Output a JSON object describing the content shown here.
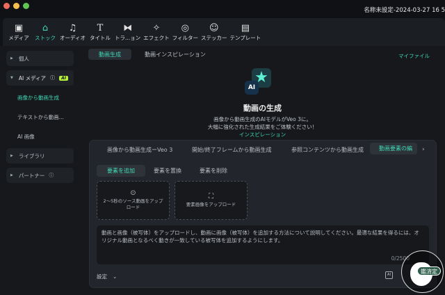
{
  "window": {
    "title": "名称未設定-2024-03-27 16 5"
  },
  "toolbar": [
    {
      "label": "メディア",
      "icon": "media-icon"
    },
    {
      "label": "ストック",
      "icon": "store-icon"
    },
    {
      "label": "オーディオ",
      "icon": "music-icon"
    },
    {
      "label": "タイトル",
      "icon": "title-icon"
    },
    {
      "label": "トラ...ョン",
      "icon": "transition-icon"
    },
    {
      "label": "エフェクト",
      "icon": "effect-icon"
    },
    {
      "label": "フィルター",
      "icon": "filter-icon"
    },
    {
      "label": "ステッカー",
      "icon": "sticker-icon"
    },
    {
      "label": "テンプレート",
      "icon": "template-icon"
    }
  ],
  "sidebar": {
    "personal": "個人",
    "ai_media": "AI メディア",
    "ai_badge": "AI",
    "sub": [
      "画像から動画生成",
      "テキストから動画...",
      "AI 画像"
    ],
    "library": "ライブラリ",
    "partner": "パートナー"
  },
  "main": {
    "tabs": [
      "動画生成",
      "動画インスピレーション"
    ],
    "my_files": "マイファイル",
    "hero": {
      "title": "動画の生成",
      "line1": "画像から動画生成のAIモデルがVeo 3に。",
      "line2": "大幅に強化された生成結果をご体験ください！",
      "link": "インスピレーション",
      "icon_text": "AI"
    },
    "mode_tabs": [
      "画像から動画生成ーVeo 3",
      "開始/終了フレームから動画生成",
      "参照コンテンツから動画生成",
      "動画要素の編"
    ],
    "sub_tabs": [
      "要素を追加",
      "要素を置換",
      "要素を削除"
    ],
    "upload_video": "2〜5秒のソース動画をアップロード",
    "upload_image": "要素画像をアップロード",
    "prompt": "動画と画像（被写体）をアップロードし、動画に画像（被写体）を追加する方法について説明してください。最適な結果を得るには、オリジナル動画となるべく動きが一致している被写体を追加するようにします。",
    "counter": "0/2500",
    "settings": "設定"
  },
  "watermark": "鑑済定",
  "colors": {
    "accent": "#3fd8b6"
  }
}
